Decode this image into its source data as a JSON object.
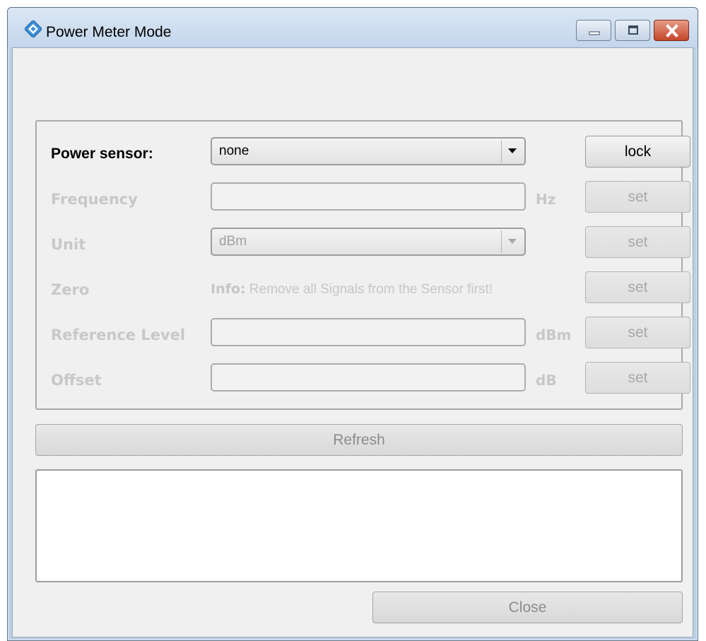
{
  "window": {
    "title": "Power Meter Mode",
    "icon": "rohde-schwarz-logo-icon"
  },
  "title_controls": {
    "minimize": "minimize-icon",
    "maximize": "maximize-icon",
    "close": "close-icon"
  },
  "sensor_group": {
    "power_sensor": {
      "label": "Power sensor:",
      "value": "none",
      "button": "lock"
    },
    "frequency": {
      "label": "Frequency",
      "value": "",
      "unit": "Hz",
      "button": "set"
    },
    "unit": {
      "label": "Unit",
      "value": "dBm",
      "button": "set"
    },
    "zero": {
      "label": "Zero",
      "info_prefix": "Info:",
      "info_text": " Remove all Signals from the Sensor first!",
      "button": "set"
    },
    "reference_level": {
      "label": "Reference Level",
      "value": "",
      "unit": "dBm",
      "button": "set"
    },
    "offset": {
      "label": "Offset",
      "value": "",
      "unit": "dB",
      "button": "set"
    }
  },
  "refresh_button": "Refresh",
  "output_log": "",
  "close_button": "Close",
  "colors": {
    "window_frame": "#bcd0e6",
    "client_bg": "#f0f0f0",
    "disabled_text": "#c8c8c8",
    "close_button_red": "#c3472a"
  }
}
